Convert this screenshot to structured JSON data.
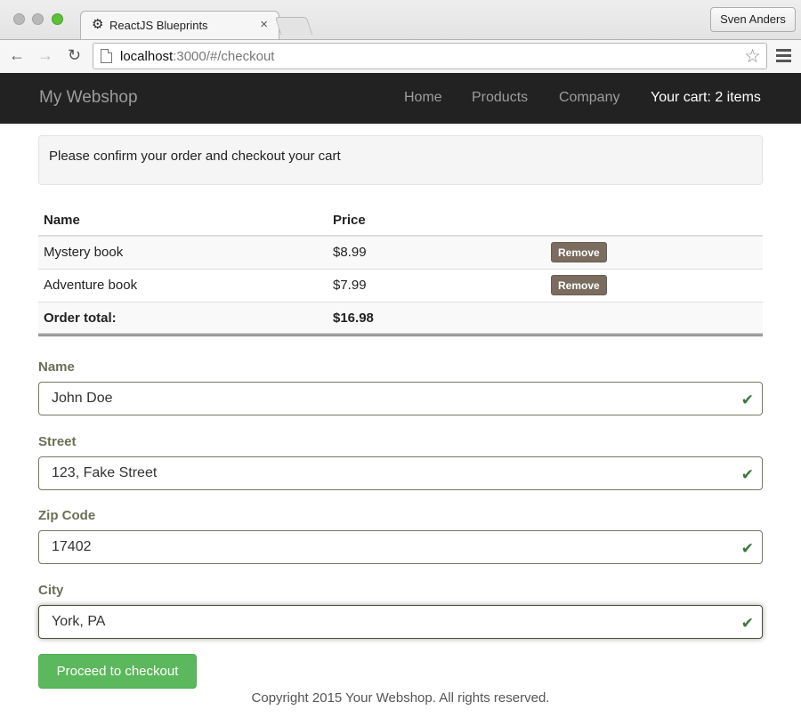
{
  "browser": {
    "tab_title": "ReactJS Blueprints",
    "profile_name": "Sven Anders",
    "url_host": "localhost",
    "url_rest": ":3000/#/checkout"
  },
  "navbar": {
    "brand": "My Webshop",
    "links": [
      "Home",
      "Products",
      "Company"
    ],
    "cart": "Your cart: 2 items"
  },
  "notice": "Please confirm your order and checkout your cart",
  "cart_table": {
    "headers": [
      "Name",
      "Price"
    ],
    "rows": [
      {
        "name": "Mystery book",
        "price": "$8.99",
        "action": "Remove"
      },
      {
        "name": "Adventure book",
        "price": "$7.99",
        "action": "Remove"
      }
    ],
    "total_label": "Order total:",
    "total_value": "$16.98"
  },
  "form": {
    "name": {
      "label": "Name",
      "value": "John Doe"
    },
    "street": {
      "label": "Street",
      "value": "123, Fake Street"
    },
    "zip": {
      "label": "Zip Code",
      "value": "17402"
    },
    "city": {
      "label": "City",
      "value": "York, PA"
    }
  },
  "checkout_button": "Proceed to checkout",
  "footer": "Copyright 2015 Your Webshop. All rights reserved.",
  "colors": {
    "navbar_bg": "#222222",
    "success_green": "#5cb85c",
    "remove_button": "#7a6c5f",
    "valid_check": "#3c763d"
  }
}
